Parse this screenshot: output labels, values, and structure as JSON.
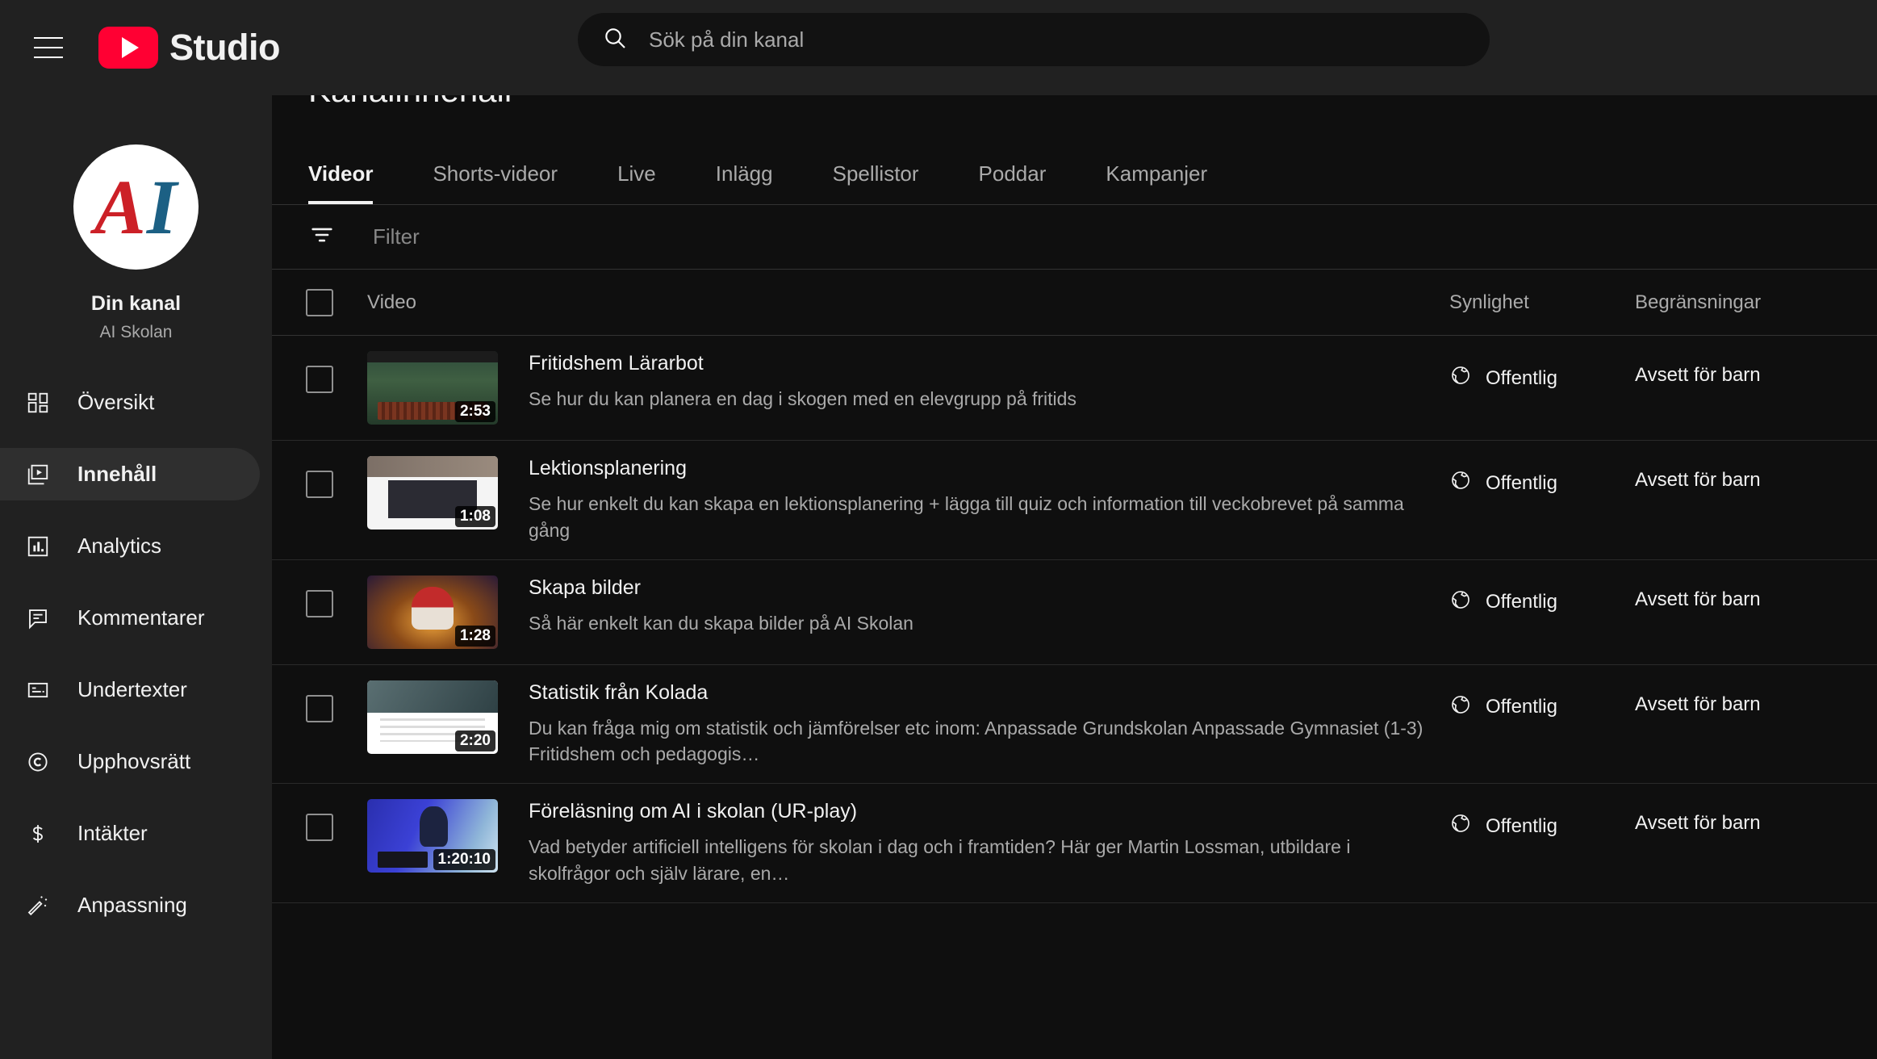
{
  "topbar": {
    "menu_icon": "hamburger-menu-icon",
    "logo_text": "Studio",
    "search_icon": "search-icon",
    "search_placeholder": "Sök på din kanal",
    "search_value": ""
  },
  "sidebar": {
    "avatar": {
      "icon": "channel-avatar",
      "letter_a": "A",
      "letter_i": "I"
    },
    "channel_label": "Din kanal",
    "channel_name": "AI Skolan",
    "items": [
      {
        "label": "Översikt",
        "icon": "dashboard-icon",
        "active": false
      },
      {
        "label": "Innehåll",
        "icon": "video-content-icon",
        "active": true
      },
      {
        "label": "Analytics",
        "icon": "bar-chart-icon",
        "active": false
      },
      {
        "label": "Kommentarer",
        "icon": "comment-icon",
        "active": false
      },
      {
        "label": "Undertexter",
        "icon": "subtitles-icon",
        "active": false
      },
      {
        "label": "Upphovsrätt",
        "icon": "copyright-icon",
        "active": false
      },
      {
        "label": "Intäkter",
        "icon": "dollar-icon",
        "active": false
      },
      {
        "label": "Anpassning",
        "icon": "magic-wand-icon",
        "active": false
      }
    ]
  },
  "main": {
    "page_title": "Kanalinnehåll",
    "tabs": [
      {
        "label": "Videor",
        "active": true
      },
      {
        "label": "Shorts-videor",
        "active": false
      },
      {
        "label": "Live",
        "active": false
      },
      {
        "label": "Inlägg",
        "active": false
      },
      {
        "label": "Spellistor",
        "active": false
      },
      {
        "label": "Poddar",
        "active": false
      },
      {
        "label": "Kampanjer",
        "active": false
      }
    ],
    "filter": {
      "icon": "filter-icon",
      "placeholder": "Filter",
      "value": ""
    },
    "columns": {
      "select_all": "select-all-checkbox",
      "video": "Video",
      "visibility": "Synlighet",
      "restrictions": "Begränsningar"
    },
    "rows": [
      {
        "title": "Fritidshem Lärarbot",
        "description": "Se hur du kan planera en dag i skogen med en elevgrupp på fritids",
        "duration": "2:53",
        "visibility": "Offentlig",
        "visibility_icon": "globe-icon",
        "restriction": "Avsett för barn",
        "thumb_class": "tb-forest",
        "checked": false
      },
      {
        "title": "Lektionsplanering",
        "description": "Se hur enkelt du kan skapa en lektionsplanering + lägga till quiz och information till veckobrevet på samma gång",
        "duration": "1:08",
        "visibility": "Offentlig",
        "visibility_icon": "globe-icon",
        "restriction": "Avsett för barn",
        "thumb_class": "tb-ui",
        "checked": false
      },
      {
        "title": "Skapa bilder",
        "description": "Så här enkelt kan du skapa bilder på AI Skolan",
        "duration": "1:28",
        "visibility": "Offentlig",
        "visibility_icon": "globe-icon",
        "restriction": "Avsett för barn",
        "thumb_class": "tb-gnome",
        "checked": false
      },
      {
        "title": "Statistik från Kolada",
        "description": "Du kan fråga mig om statistik och jämförelser etc inom: Anpassade Grundskolan Anpassade Gymnasiet (1-3) Fritidshem och pedagogis…",
        "duration": "2:20",
        "visibility": "Offentlig",
        "visibility_icon": "globe-icon",
        "restriction": "Avsett för barn",
        "thumb_class": "tb-stat",
        "checked": false
      },
      {
        "title": "Föreläsning om AI i skolan (UR-play)",
        "description": "Vad betyder artificiell intelligens för skolan i dag och i framtiden? Här ger Martin Lossman, utbildare i skolfrågor och själv lärare, en…",
        "duration": "1:20:10",
        "visibility": "Offentlig",
        "visibility_icon": "globe-icon",
        "restriction": "Avsett för barn",
        "thumb_class": "tb-lect",
        "checked": false
      }
    ]
  }
}
